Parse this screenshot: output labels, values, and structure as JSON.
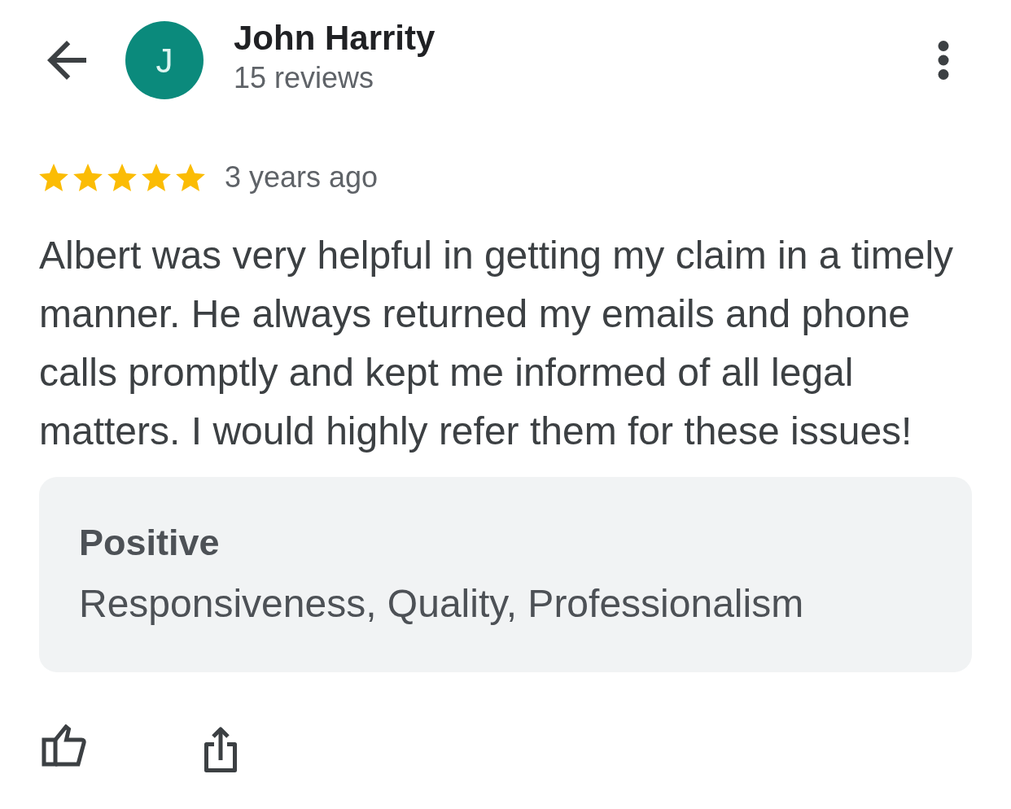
{
  "reviewer": {
    "avatar_letter": "J",
    "name": "John Harrity",
    "review_count": "15 reviews"
  },
  "review": {
    "stars": 5,
    "time": "3 years ago",
    "text": "Albert was very helpful in getting my claim in a timely manner. He always returned my emails and phone calls promptly and kept me informed of all legal matters. I would highly refer them for these issues!"
  },
  "highlights": {
    "title": "Positive",
    "text": "Responsiveness, Quality, Professionalism"
  }
}
